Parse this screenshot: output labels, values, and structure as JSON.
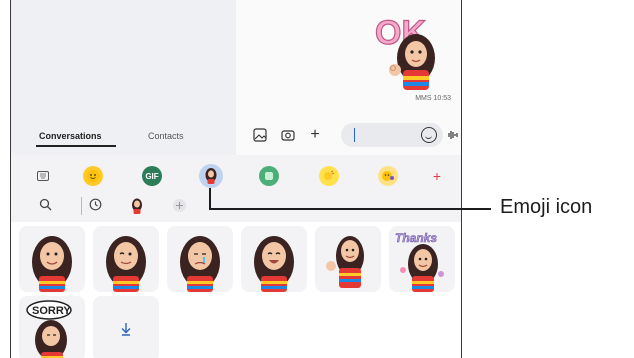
{
  "tabs": [
    {
      "label": "Conversations",
      "selected": true
    },
    {
      "label": "Contacts",
      "selected": false
    }
  ],
  "message": {
    "meta": "MMS 10:53",
    "sticker_text": "OK"
  },
  "tools": [
    {
      "icon": "keyboard-icon",
      "label": ""
    },
    {
      "icon": "emoji-face-icon",
      "label": ""
    },
    {
      "icon": "gif-icon",
      "label": "GIF"
    },
    {
      "icon": "avatar-emoji-icon",
      "label": "",
      "selected": true
    },
    {
      "icon": "sticker-icon",
      "label": ""
    },
    {
      "icon": "bitmoji-icon",
      "label": ""
    },
    {
      "icon": "animated-emoji-icon",
      "label": ""
    },
    {
      "icon": "plus-icon",
      "label": "+"
    }
  ],
  "stickers": [
    {
      "pose": "smile"
    },
    {
      "pose": "wink"
    },
    {
      "pose": "cry"
    },
    {
      "pose": "laugh"
    },
    {
      "pose": "ok-hand"
    },
    {
      "pose": "thanks",
      "text": "Thanks"
    },
    {
      "pose": "sorry",
      "text": "SORRY"
    }
  ],
  "callout": {
    "label": "Emoji icon"
  },
  "colors": {
    "accent": "#2a63c7",
    "selected_bg": "#bfd2ef",
    "hair": "#3a2320",
    "skin": "#f3c6a6"
  }
}
